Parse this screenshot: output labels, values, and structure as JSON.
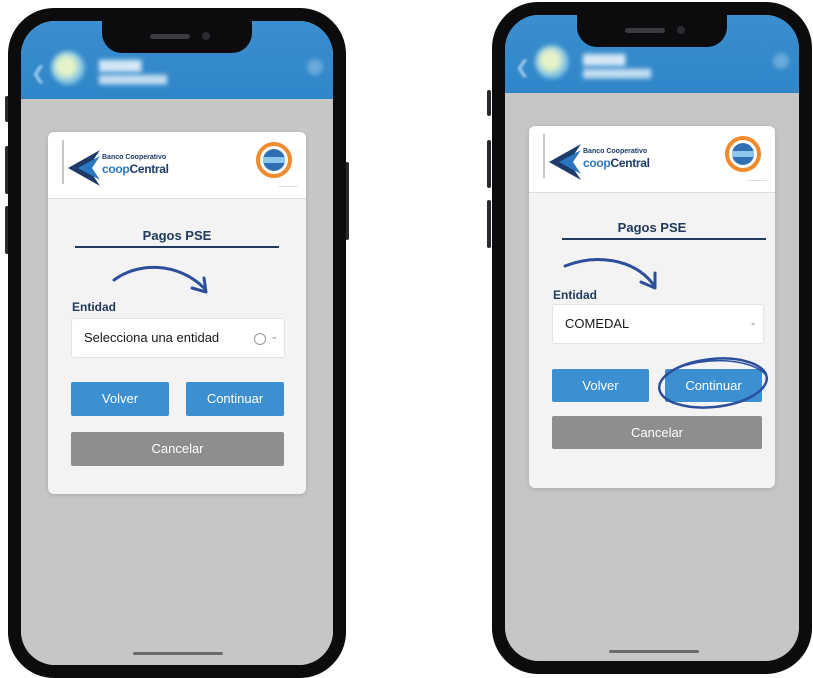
{
  "colors": {
    "brand_blue": "#2f86c8",
    "navy": "#1f3a5c",
    "button_blue": "#3c8fd1",
    "button_gray": "#8e8e8e",
    "annotation": "#2c4f9c"
  },
  "screens": [
    {
      "bank": {
        "line1": "Banco Cooperativo",
        "coop": "coop",
        "central": "Central"
      },
      "title": "Pagos PSE",
      "entity_label": "Entidad",
      "entity_value": "Selecciona una entidad",
      "back_label": "Volver",
      "continue_label": "Continuar",
      "cancel_label": "Cancelar",
      "continue_circled": false
    },
    {
      "bank": {
        "line1": "Banco Cooperativo",
        "coop": "coop",
        "central": "Central"
      },
      "title": "Pagos PSE",
      "entity_label": "Entidad",
      "entity_value": "COMEDAL",
      "back_label": "Volver",
      "continue_label": "Continuar",
      "cancel_label": "Cancelar",
      "continue_circled": true
    }
  ],
  "icons": [
    "back-icon",
    "avatar",
    "menu-icon",
    "bank-logo-icon",
    "pse-logo-icon",
    "chevron-down-icon",
    "radio-circle-icon",
    "curved-arrow-icon",
    "circle-highlight-annotation"
  ]
}
